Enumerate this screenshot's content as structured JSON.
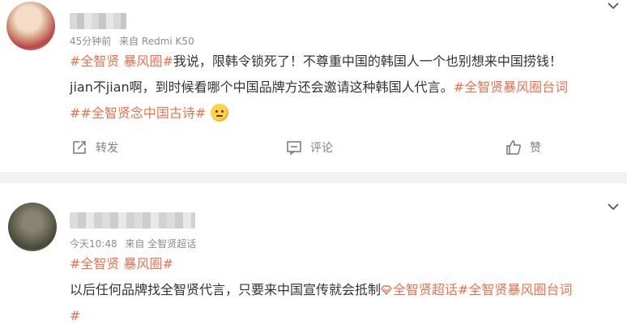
{
  "post1": {
    "time": "45分钟前",
    "source": "来自 Redmi K50",
    "content": {
      "tag1": "#全智贤 暴风圈#",
      "line1_rest": "我说，限韩令锁死了！不尊重中国的韩国人一个也别想来中国捞钱！",
      "line2_text": "jian不jian啊，到时候看哪个中国品牌方还会邀请这种韩国人代言。",
      "tag2": "#全智贤暴风圈台词",
      "tag3": "##全智贤念中国古诗#",
      "emoji": "thinking-emoji"
    },
    "actions": {
      "repost": "转发",
      "comment": "评论",
      "like": "赞"
    }
  },
  "post2": {
    "time": "今天10:48",
    "source": "来自 全智贤超话",
    "content": {
      "tag1": "#全智贤 暴风圈#",
      "line2_text": "以后任何品牌找全智贤代言，只要来中国宣传就会抵制",
      "tag2": "全智贤超话",
      "tag3": "#全智贤暴风圈台词",
      "line3": "#"
    }
  },
  "icons": {
    "menu": "chevron-down-icon",
    "repost": "repost-icon",
    "comment": "comment-icon",
    "like": "thumbs-up-icon",
    "supertopic": "supertopic-icon"
  },
  "colors": {
    "accent": "#eb7350",
    "separator": "#f1f2f5",
    "meta": "#8c8c8c"
  }
}
